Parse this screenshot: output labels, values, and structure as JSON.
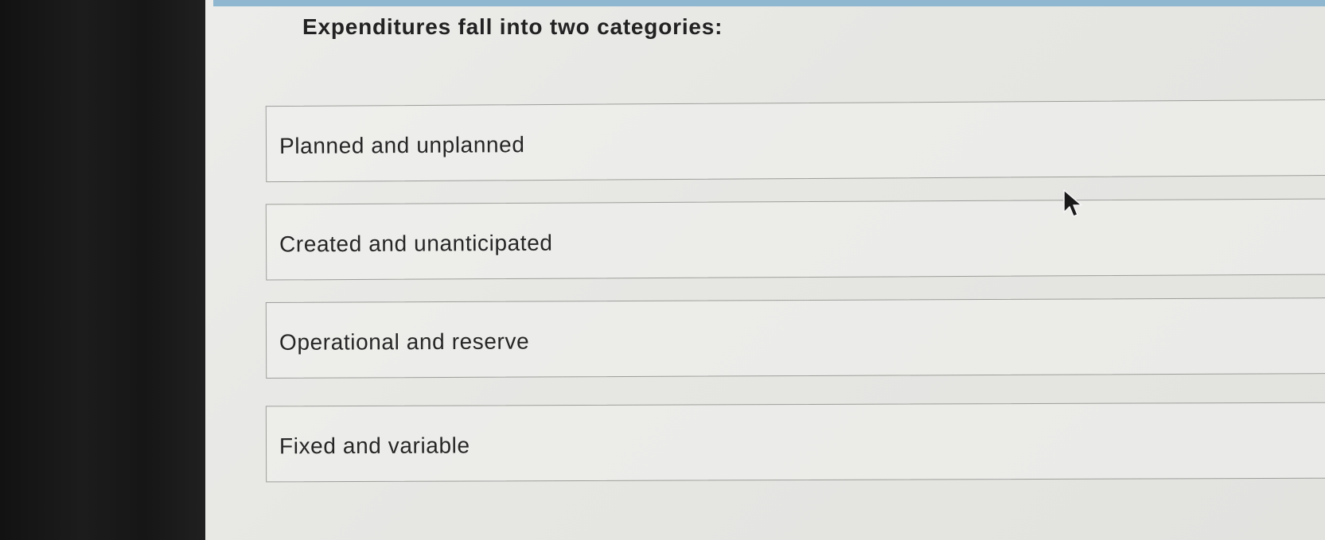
{
  "question": {
    "text": "Expenditures fall into two categories:"
  },
  "options": [
    {
      "label": "Planned and unplanned"
    },
    {
      "label": "Created and unanticipated"
    },
    {
      "label": "Operational and reserve"
    },
    {
      "label": "Fixed and variable"
    }
  ],
  "cursor": {
    "icon": "mouse-pointer-icon"
  },
  "colors": {
    "background": "#e6e6e3",
    "text": "#262626",
    "border": "#9d9d9a",
    "accent_strip": "#8fb7d0"
  }
}
